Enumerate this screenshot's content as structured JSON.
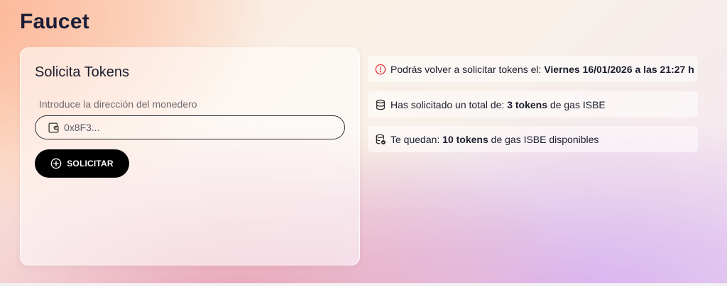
{
  "page": {
    "title": "Faucet"
  },
  "request_card": {
    "title": "Solicita Tokens",
    "wallet_label": "Introduce la dirección del monedero",
    "wallet_placeholder": "0x8F3...",
    "wallet_value": "",
    "submit_label": "SOLICITAR",
    "wallet_icon": "wallet-icon",
    "submit_icon": "plus-circle-icon"
  },
  "info": [
    {
      "icon": "alert-circle-icon",
      "prefix": "Podrás volver a solicitar tokens el: ",
      "strong": "Viernes 16/01/2026 a las 21:27 h",
      "suffix": ""
    },
    {
      "icon": "database-icon",
      "prefix": "Has solicitado un total de: ",
      "strong": "3 tokens",
      "suffix": " de gas ISBE"
    },
    {
      "icon": "database-check-icon",
      "prefix": "Te quedan: ",
      "strong": "10 tokens",
      "suffix": " de gas ISBE disponibles"
    }
  ],
  "colors": {
    "accent_alert": "#e53935",
    "button_bg": "#000000",
    "title_text": "#1b1d36"
  }
}
